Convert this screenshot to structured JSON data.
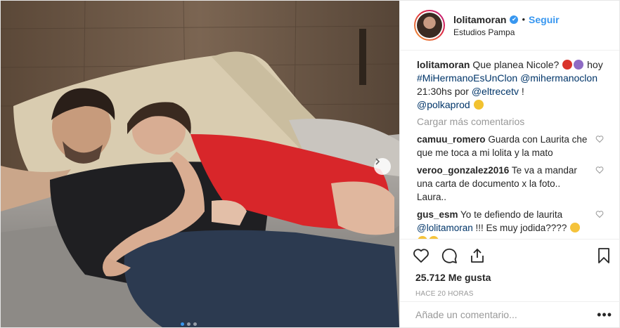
{
  "post": {
    "author": {
      "username": "lolitamoran",
      "follow_label": "Seguir",
      "separator": "•",
      "location": "Estudios Pampa"
    },
    "caption": {
      "username": "lolitamoran",
      "text_1": "Que planea Nicole?",
      "text_2": "hoy",
      "hashtag": "#MiHermanoEsUnClon",
      "mention_1": "@mihermanoclon",
      "text_3": "21:30hs por",
      "mention_2": "@eltrecetv",
      "text_4": "!",
      "mention_3": "@polkaprod"
    },
    "load_more_label": "Cargar más comentarios",
    "comments": [
      {
        "username": "camuu_romero",
        "text": "Guarda con Laurita che que me toca a mi lolita y la mato"
      },
      {
        "username": "veroo_gonzalez2016",
        "text": "Te va a mandar una carta de documento x la foto.. Laura.."
      },
      {
        "username": "gus_esm",
        "text": "Yo te defiendo de laurita",
        "mention": "@lolitamoran",
        "text_after": "!!! Es muy jodida????"
      }
    ],
    "likes": "25.712 Me gusta",
    "timestamp": "HACE 20 HORAS",
    "add_comment_placeholder": "Añade un comentario...",
    "more_options": "•••"
  },
  "colors": {
    "accent": "#3897f0",
    "link": "#003569",
    "muted": "#999999",
    "dress": "#d8262a"
  },
  "icons": [
    "verified-badge-icon",
    "next-arrow-icon",
    "heart-icon",
    "comment-icon",
    "share-icon",
    "bookmark-icon",
    "small-heart-icon"
  ]
}
